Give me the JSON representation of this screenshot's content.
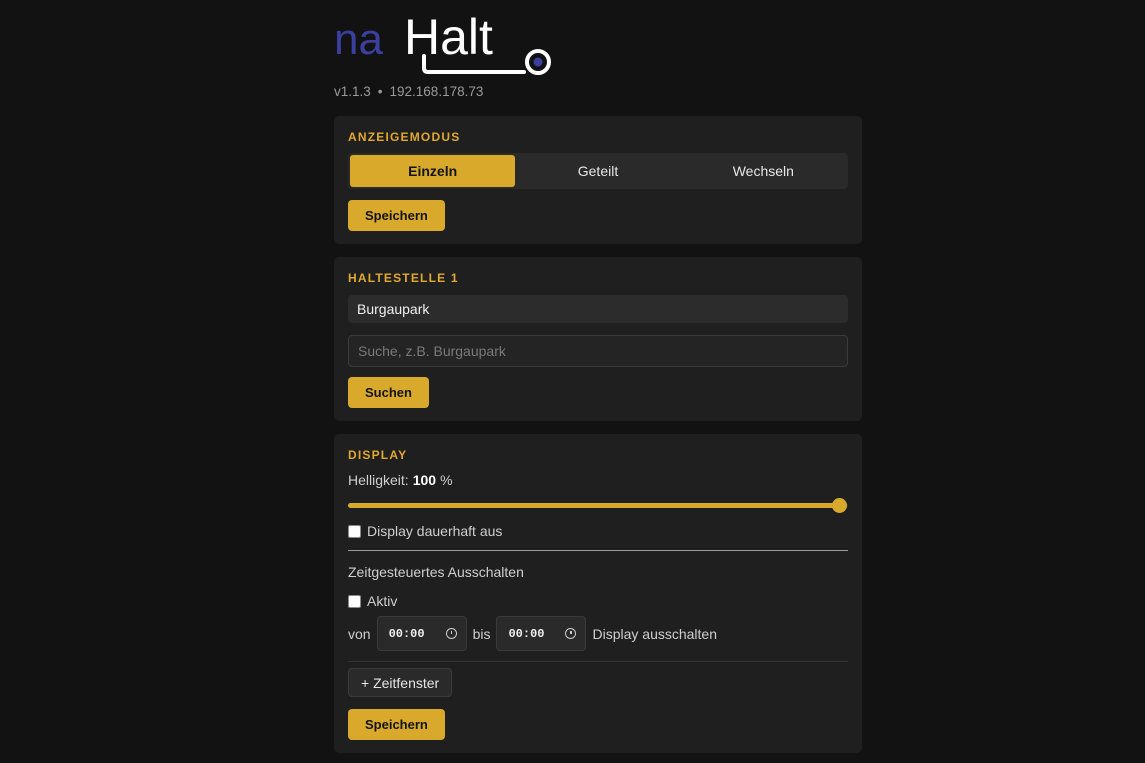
{
  "header": {
    "logo": {
      "prefix": "na",
      "main": "Halt"
    },
    "version": "v1.1.3",
    "separator": "•",
    "ip": "192.168.178.73"
  },
  "display_mode": {
    "title": "ANZEIGEMODUS",
    "options": [
      "Einzeln",
      "Geteilt",
      "Wechseln"
    ],
    "selected": "Einzeln",
    "save_label": "Speichern"
  },
  "stop1": {
    "title": "HALTESTELLE 1",
    "current": "Burgaupark",
    "search_placeholder": "Suche, z.B. Burgaupark",
    "search_value": "",
    "search_label": "Suchen"
  },
  "display": {
    "title": "DISPLAY",
    "brightness_label": "Helligkeit:",
    "brightness_value": "100",
    "brightness_unit": "%",
    "brightness_fraction": 1.0,
    "off_label": "Display dauerhaft aus",
    "off_checked": false,
    "schedule_heading": "Zeitgesteuertes Ausschalten",
    "active_label": "Aktiv",
    "active_checked": false,
    "from_label": "von",
    "from_time": "00:00",
    "to_label": "bis",
    "to_time": "00:00",
    "action_label": "Display ausschalten",
    "add_window_label": "+ Zeitfenster",
    "save_label": "Speichern"
  },
  "colors": {
    "accent": "#d9a92c",
    "logo_blue": "#3b3f9e",
    "background": "#121212",
    "card": "#1f1f1f"
  }
}
